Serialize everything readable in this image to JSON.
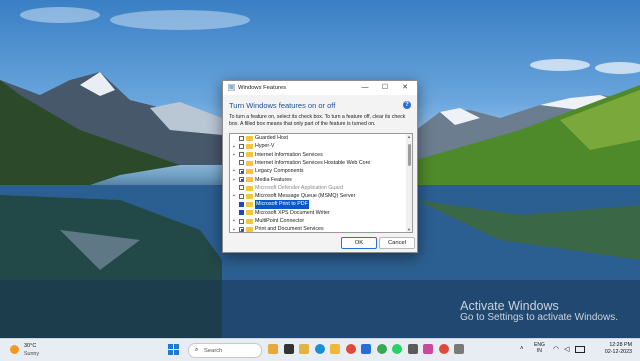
{
  "watermark": {
    "title": "Activate Windows",
    "subtitle": "Go to Settings to activate Windows."
  },
  "dialog": {
    "title": "Windows Features",
    "heading": "Turn Windows features on or off",
    "help_icon": "?",
    "description": "To turn a feature on, select its check box. To turn a feature off, clear its check box. A filled box means that only part of the feature is turned on.",
    "minimize_glyph": "—",
    "maximize_glyph": "☐",
    "close_glyph": "✕",
    "features": [
      {
        "label": "Guarded Host",
        "expander": false,
        "state": "unchecked",
        "disabled": false,
        "selected": false
      },
      {
        "label": "Hyper-V",
        "expander": true,
        "state": "unchecked",
        "disabled": false,
        "selected": false
      },
      {
        "label": "Internet Information Services",
        "expander": true,
        "state": "unchecked",
        "disabled": false,
        "selected": false
      },
      {
        "label": "Internet Information Services Hostable Web Core",
        "expander": false,
        "state": "unchecked",
        "disabled": false,
        "selected": false
      },
      {
        "label": "Legacy Components",
        "expander": true,
        "state": "partial",
        "disabled": false,
        "selected": false
      },
      {
        "label": "Media Features",
        "expander": true,
        "state": "partial",
        "disabled": false,
        "selected": false
      },
      {
        "label": "Microsoft Defender Application Guard",
        "expander": false,
        "state": "unchecked",
        "disabled": true,
        "selected": false
      },
      {
        "label": "Microsoft Message Queue (MSMQ) Server",
        "expander": true,
        "state": "unchecked",
        "disabled": false,
        "selected": false
      },
      {
        "label": "Microsoft Print to PDF",
        "expander": false,
        "state": "checked",
        "disabled": false,
        "selected": true
      },
      {
        "label": "Microsoft XPS Document Writer",
        "expander": false,
        "state": "checked",
        "disabled": false,
        "selected": false
      },
      {
        "label": "MultiPoint Connector",
        "expander": true,
        "state": "unchecked",
        "disabled": false,
        "selected": false
      },
      {
        "label": "Print and Document Services",
        "expander": true,
        "state": "partial",
        "disabled": false,
        "selected": false
      }
    ],
    "ok_label": "OK",
    "cancel_label": "Cancel"
  },
  "taskbar": {
    "weather_temp": "30°C",
    "weather_condition": "Sunny",
    "search_placeholder": "Search",
    "language_line1": "ENG",
    "language_line2": "IN",
    "time": "12:28 PM",
    "date": "02-12-2023",
    "pinned_icons": [
      "widgets-icon",
      "task-view-icon",
      "file-explorer-icon",
      "edge-icon",
      "folder-icon",
      "chrome-icon",
      "store-icon",
      "chrome-icon",
      "whatsapp-icon",
      "camera-icon",
      "app-icon",
      "chrome-icon",
      "app-icon"
    ]
  },
  "colors": {
    "accent": "#0a57c9",
    "heading": "#1e4f91",
    "folder": "#f5c542"
  }
}
